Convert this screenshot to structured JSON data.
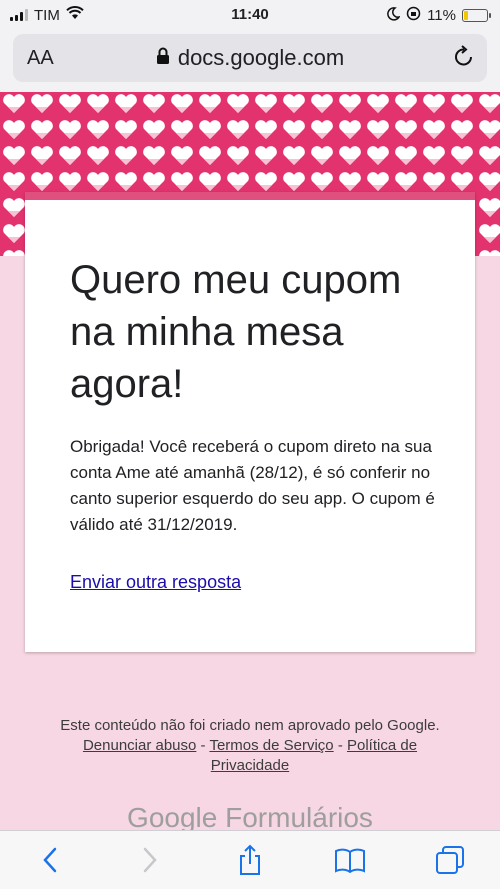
{
  "status_bar": {
    "carrier": "TIM",
    "time": "11:40",
    "battery": "11%"
  },
  "browser": {
    "text_size_label": "AA",
    "url": "docs.google.com"
  },
  "form": {
    "title": "Quero meu cupom na minha mesa agora!",
    "confirmation": "Obrigada! Você receberá o cupom direto na sua conta Ame até amanhã (28/12), é só conferir no canto superior esquerdo do seu app. O cupom é válido até 31/12/2019.",
    "another_response_link": "Enviar outra resposta"
  },
  "footer": {
    "disclaimer": "Este conteúdo não foi criado nem aprovado pelo Google.",
    "report_abuse": "Denunciar abuso",
    "separator": " - ",
    "terms": "Termos de Serviço",
    "privacy": "Política de Privacidade",
    "brand_google": "Google",
    "brand_forms": "Formulários"
  },
  "colors": {
    "banner": "#e3336f",
    "card_accent": "#e0507f",
    "page_bg": "#f6d7e3",
    "link": "#1a0dab"
  },
  "icons": [
    "wifi-icon",
    "lock-icon",
    "reload-icon",
    "back-icon",
    "forward-icon",
    "share-icon",
    "bookmarks-icon",
    "tabs-icon"
  ]
}
